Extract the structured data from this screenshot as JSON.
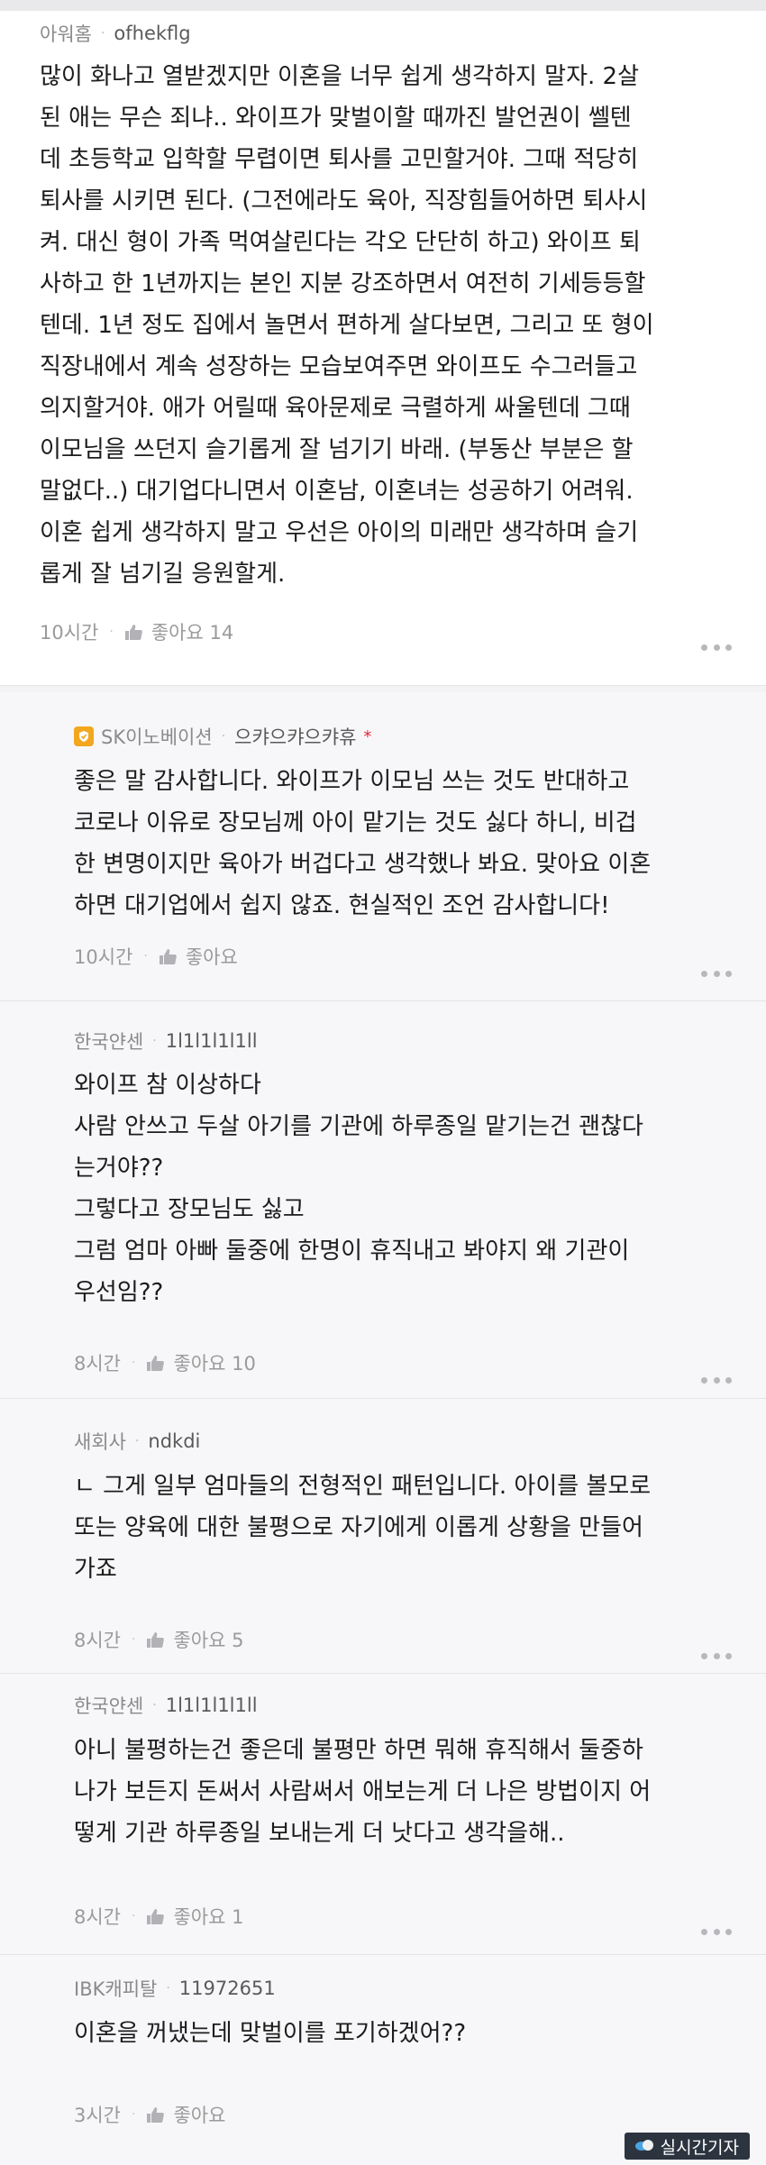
{
  "top_comment": {
    "company": "아워홈",
    "nickname": "ofhekflg",
    "body": "많이 화나고 열받겠지만 이혼을 너무 쉽게 생각하지 말자. 2살\n된 애는 무슨 죄냐.. 와이프가 맞벌이할 때까진 발언권이 쎌텐\n데 초등학교 입학할 무렵이면 퇴사를 고민할거야. 그때 적당히\n퇴사를 시키면 된다. (그전에라도 육아, 직장힘들어하면 퇴사시\n켜. 대신 형이 가족 먹여살린다는 각오 단단히 하고) 와이프 퇴\n사하고 한 1년까지는 본인 지분 강조하면서 여전히 기세등등할\n텐데. 1년 정도 집에서 놀면서 편하게 살다보면, 그리고 또 형이\n직장내에서 계속 성장하는 모습보여주면 와이프도 수그러들고\n의지할거야. 애가 어릴때 육아문제로 극렬하게 싸울텐데 그때\n이모님을 쓰던지 슬기롭게 잘 넘기기 바래. (부동산 부분은 할\n말없다..) 대기업다니면서 이혼남, 이혼녀는 성공하기 어려워.\n이혼 쉽게 생각하지 말고 우선은 아이의 미래만 생각하며 슬기\n롭게 잘 넘기길 응원할게.",
    "time": "10시간",
    "like_label": "좋아요 14"
  },
  "replies": [
    {
      "company": "SK이노베이션",
      "nickname": "으캬으캬으캬휴",
      "author_mark": "*",
      "badge_color": "#f2a71f",
      "body": "좋은 말 감사합니다. 와이프가 이모님 쓰는 것도 반대하고\n코로나 이유로 장모님께 아이 맡기는 것도 싫다 하니, 비겁\n한 변명이지만 육아가 버겁다고 생각했나 봐요. 맞아요 이혼\n하면 대기업에서 쉽지 않죠. 현실적인 조언 감사합니다!",
      "time": "10시간",
      "like_label": "좋아요"
    },
    {
      "company": "한국얀센",
      "nickname": "1l1l1l1l1ll",
      "body": "와이프 참 이상하다\n사람 안쓰고 두살 아기를 기관에 하루종일 맡기는건 괜찮다\n는거야??\n그렇다고 장모님도 싫고\n그럼 엄마 아빠 둘중에 한명이 휴직내고 봐야지 왜 기관이\n우선임??",
      "time": "8시간",
      "like_label": "좋아요 10"
    },
    {
      "company": "새회사",
      "nickname": "ndkdi",
      "body": "ㄴ 그게 일부 엄마들의 전형적인 패턴입니다. 아이를 볼모로\n또는 양육에 대한 불평으로 자기에게 이롭게 상황을 만들어\n가죠",
      "time": "8시간",
      "like_label": "좋아요 5"
    },
    {
      "company": "한국얀센",
      "nickname": "1l1l1l1l1ll",
      "body": "아니 불평하는건 좋은데 불평만 하면 뭐해 휴직해서 둘중하\n나가 보든지 돈써서 사람써서 애보는게 더 나은 방법이지 어\n떻게 기관 하루종일 보내는게 더 낫다고 생각을해..",
      "time": "8시간",
      "like_label": "좋아요 1"
    },
    {
      "company": "IBK캐피탈",
      "nickname": "11972651",
      "body": "이혼을 꺼냈는데 맞벌이를 포기하겠어??",
      "time": "3시간",
      "like_label": "좋아요"
    }
  ],
  "watermark": "실시간기자",
  "colors": {
    "reply_bg": "#f7f7f9",
    "muted_text": "#888888",
    "author_mark": "#e0263b"
  },
  "icons": {
    "like": "thumbs-up-icon",
    "more": "more-dots-icon",
    "badge": "verified-badge-icon"
  }
}
